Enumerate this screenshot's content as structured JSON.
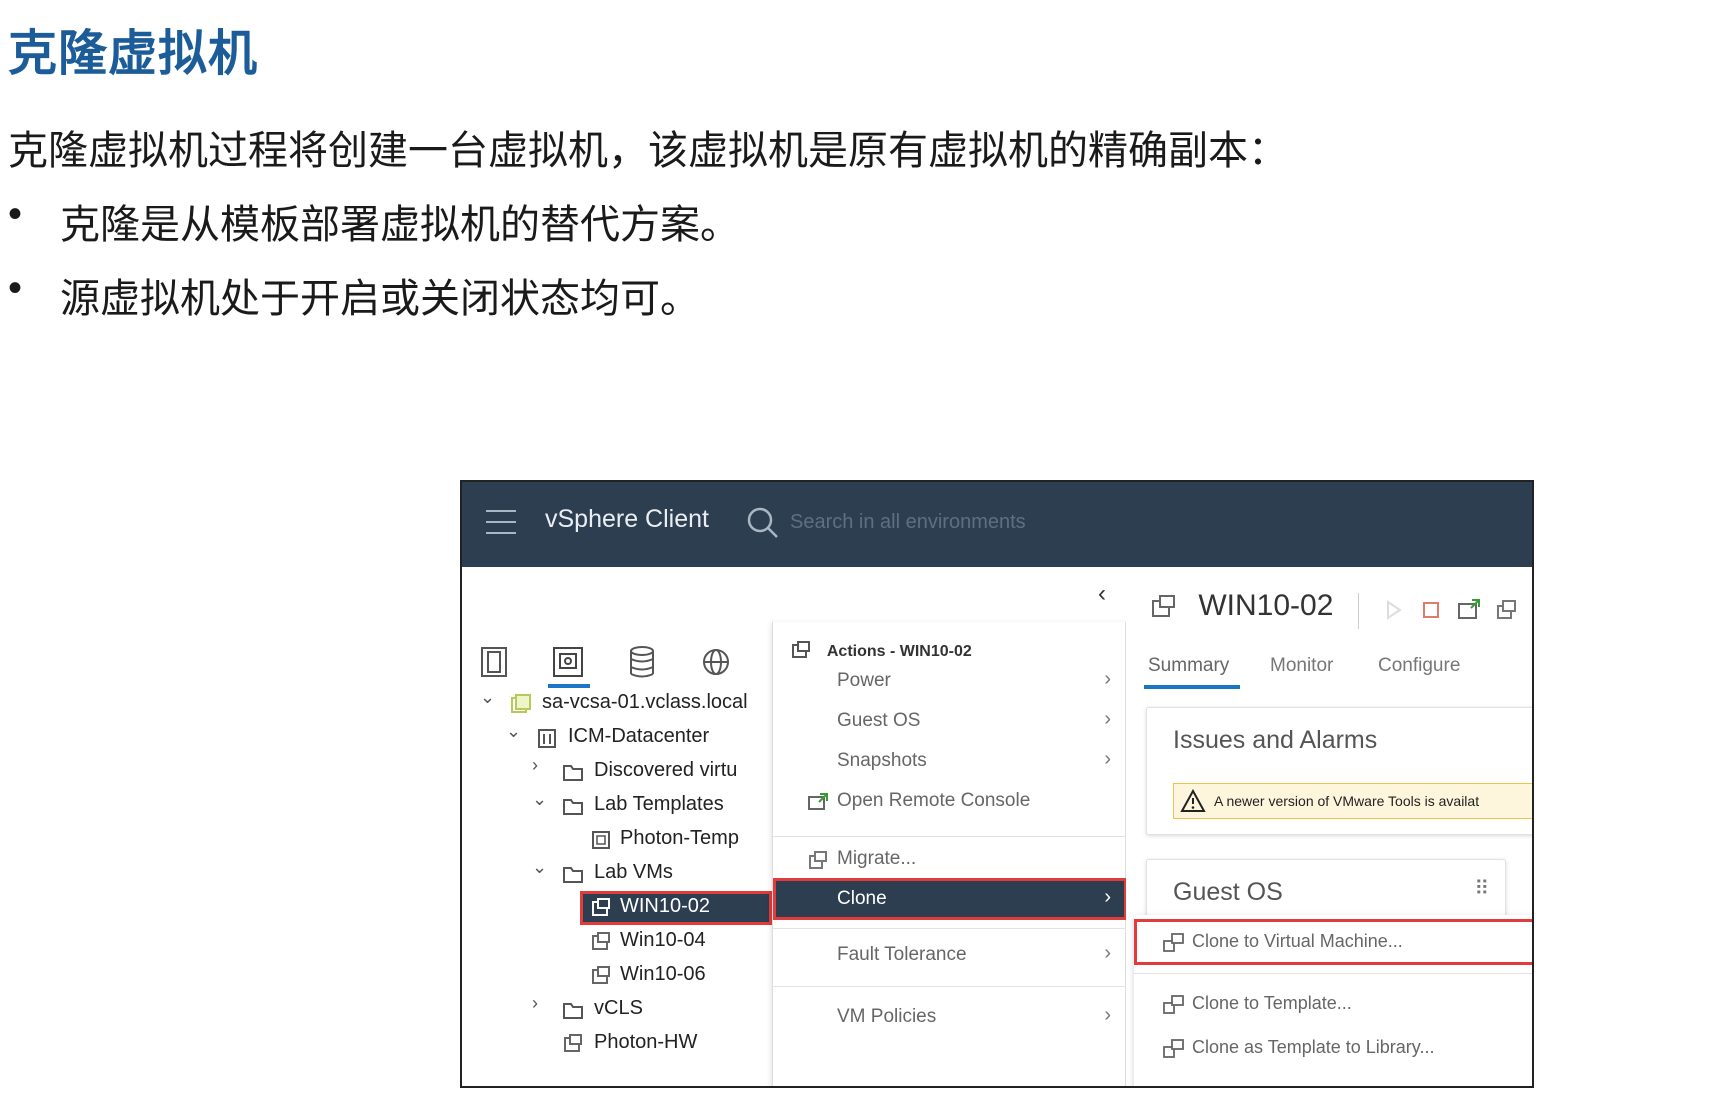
{
  "slide": {
    "title": "克隆虚拟机",
    "intro": "克隆虚拟机过程将创建一台虚拟机，该虚拟机是原有虚拟机的精确副本：",
    "bullet_char": "•",
    "bullets": [
      "克隆是从模板部署虚拟机的替代方案。",
      "源虚拟机处于开启或关闭状态均可。"
    ]
  },
  "client": {
    "app_title": "vSphere Client",
    "search_placeholder": "Search in all environments",
    "colors": {
      "header_bg": "#2c3e50",
      "accent": "#1b76c6",
      "highlight": "#e23b3b"
    }
  },
  "navtabs": [
    {
      "name": "hosts-clusters-icon"
    },
    {
      "name": "vms-templates-icon",
      "active": true
    },
    {
      "name": "storage-icon"
    },
    {
      "name": "networking-icon"
    }
  ],
  "tree": [
    {
      "label": "sa-vcsa-01.vclass.local",
      "chevron": "⌄",
      "icon": "vcenter-icon"
    },
    {
      "label": "ICM-Datacenter",
      "chevron": "⌄",
      "icon": "datacenter-icon"
    },
    {
      "label": "Discovered virtu",
      "chevron": "›",
      "icon": "folder-icon"
    },
    {
      "label": "Lab Templates",
      "chevron": "⌄",
      "icon": "folder-icon"
    },
    {
      "label": "Photon-Temp",
      "chevron": "",
      "icon": "template-icon"
    },
    {
      "label": "Lab VMs",
      "chevron": "⌄",
      "icon": "folder-icon"
    },
    {
      "label": "WIN10-02",
      "chevron": "",
      "icon": "vm-icon",
      "selected": true
    },
    {
      "label": "Win10-04",
      "chevron": "",
      "icon": "vm-icon"
    },
    {
      "label": "Win10-06",
      "chevron": "",
      "icon": "vm-icon"
    },
    {
      "label": "vCLS",
      "chevron": "›",
      "icon": "folder-icon"
    },
    {
      "label": "Photon-HW",
      "chevron": "",
      "icon": "vm-icon"
    }
  ],
  "actions_menu": {
    "header": "Actions - WIN10-02",
    "items": [
      {
        "label": "Power",
        "has_submenu": true
      },
      {
        "label": "Guest OS",
        "has_submenu": true
      },
      {
        "label": "Snapshots",
        "has_submenu": true
      },
      {
        "label": "Open Remote Console",
        "icon": "remote-console-icon"
      },
      {
        "label": "Migrate...",
        "icon": "migrate-icon"
      },
      {
        "label": "Clone",
        "has_submenu": true,
        "active": true
      },
      {
        "label": "Fault Tolerance",
        "has_submenu": true
      },
      {
        "label": "VM Policies",
        "has_submenu": true
      }
    ],
    "arrow": "›"
  },
  "vm": {
    "name": "WIN10-02",
    "tabs": [
      "Summary",
      "Monitor",
      "Configure"
    ],
    "active_tab": "Summary",
    "issues_title": "Issues and Alarms",
    "alert_text": "A newer version of VMware Tools is availat",
    "guest_title": "Guest OS",
    "drag_handle": "⠿"
  },
  "clone_submenu": [
    {
      "label": "Clone to Virtual Machine...",
      "highlight": true
    },
    {
      "label": "Clone to Template..."
    },
    {
      "label": "Clone as Template to Library..."
    }
  ],
  "collapse_chevron": "‹"
}
